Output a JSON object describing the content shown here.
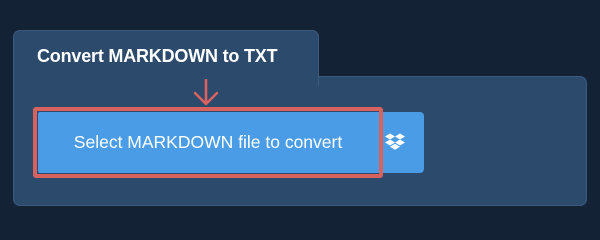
{
  "converter": {
    "title": "Convert MARKDOWN to TXT",
    "select_button_label": "Select MARKDOWN file to convert",
    "dropbox_icon": "dropbox-icon",
    "arrow_icon": "arrow-down-icon"
  },
  "colors": {
    "page_background": "#142236",
    "panel_background": "#2c4a6c",
    "button_background": "#4a9ce6",
    "highlight": "#d9625f"
  }
}
